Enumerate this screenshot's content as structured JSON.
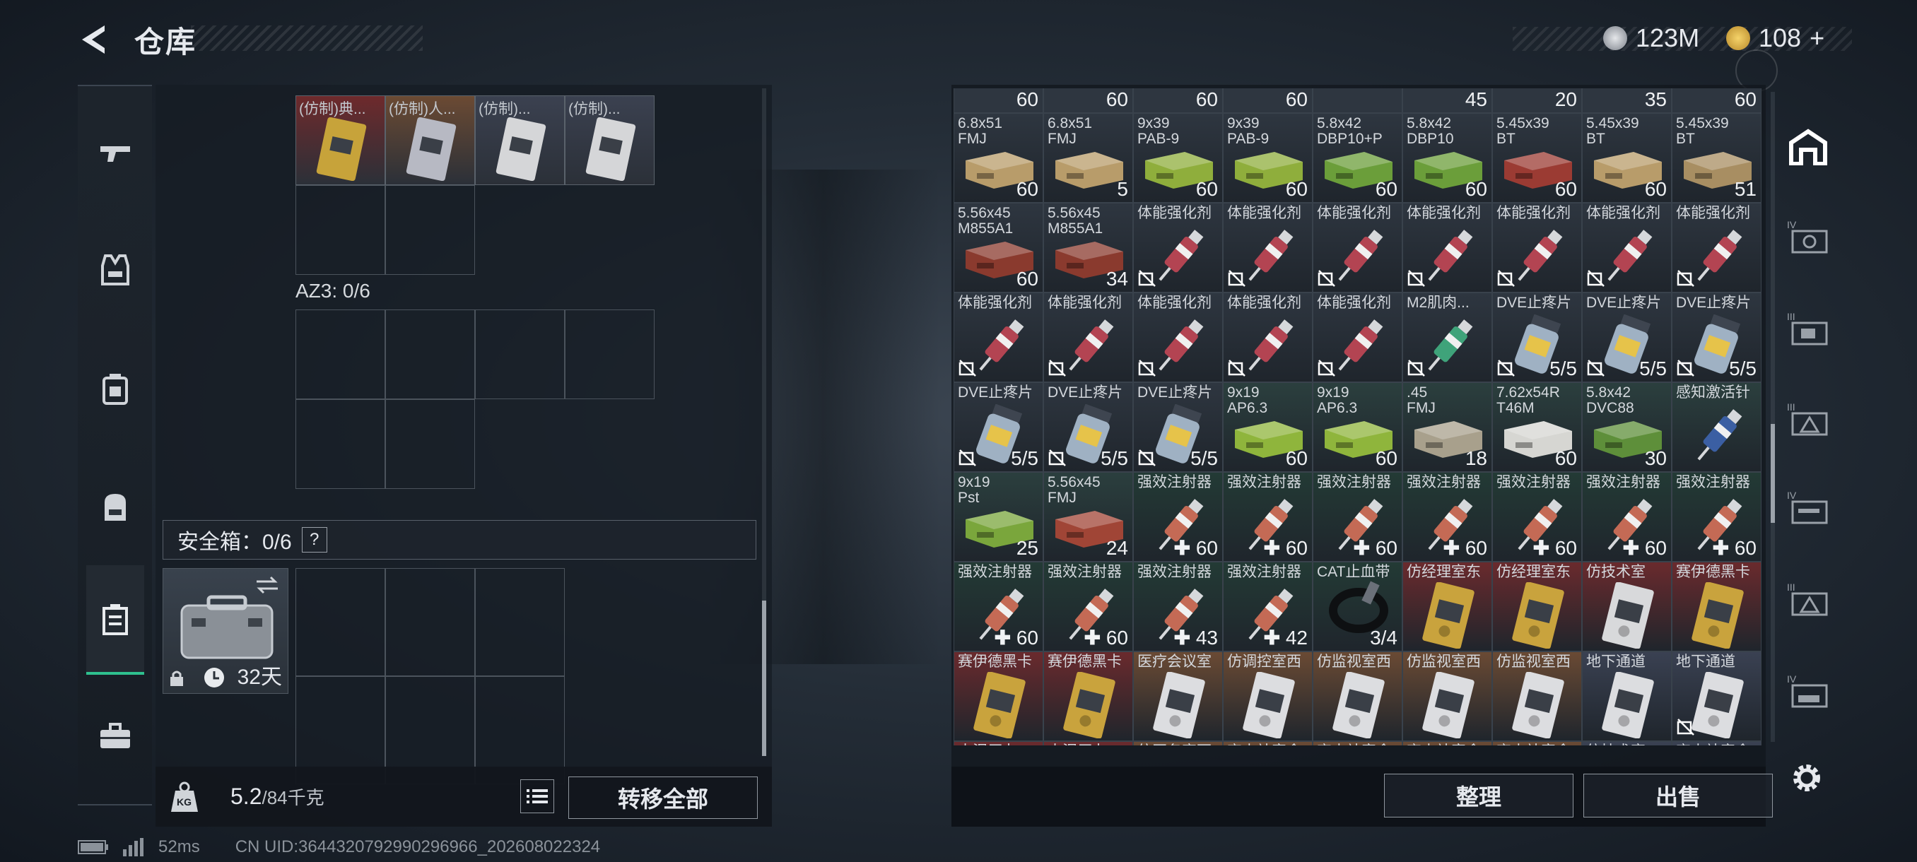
{
  "header": {
    "title": "仓库",
    "currency1": "123M",
    "currency2": "108",
    "currency2_plus": "+"
  },
  "nav": [
    "weapon-icon",
    "vest-icon",
    "armor-icon",
    "backpack-icon",
    "container-icon",
    "toolbox-icon"
  ],
  "left": {
    "top_items": [
      {
        "label": "(仿制)典...",
        "bg": "#6e2a2c",
        "card": "#c7a33a"
      },
      {
        "label": "(仿制)人...",
        "bg": "#6b4a33",
        "card": "#b7b9c3"
      },
      {
        "label": "(仿制)...",
        "bg": "#3b4150",
        "card": "#d5d6d8"
      },
      {
        "label": "(仿制)...",
        "bg": "#3b4150",
        "card": "#d5d6d8"
      }
    ],
    "az3_label": "AZ3: 0/6",
    "safe_label": "安全箱：0/6",
    "help": "?",
    "safe_days": "32天",
    "weight_value": "5.2",
    "weight_max": "/84千克",
    "kg_label": "KG",
    "transfer_label": "转移全部"
  },
  "status": {
    "ping": "52ms",
    "uid": "CN UID:3644320792990296966_202608022324"
  },
  "inventory": {
    "top_counts": [
      "60",
      "60",
      "60",
      "60",
      "",
      "45",
      "20",
      "35",
      "60"
    ],
    "rows": [
      [
        {
          "n": "6.8x51\nFMJ",
          "c": "60",
          "t": "ammo",
          "col": "#b89c6a",
          "bg": "#2e3640"
        },
        {
          "n": "6.8x51\nFMJ",
          "c": "5",
          "t": "ammo",
          "col": "#b89c6a",
          "bg": "#2e3640"
        },
        {
          "n": "9x39\nPAB-9",
          "c": "60",
          "t": "ammo",
          "col": "#8fae3c",
          "bg": "#2e3640"
        },
        {
          "n": "9x39\nPAB-9",
          "c": "60",
          "t": "ammo",
          "col": "#8fae3c",
          "bg": "#2e3640"
        },
        {
          "n": "5.8x42\nDBP10+P",
          "c": "60",
          "t": "ammo",
          "col": "#6b9e3a",
          "bg": "#2e3640"
        },
        {
          "n": "5.8x42\nDBP10",
          "c": "60",
          "t": "ammo",
          "col": "#6b9e3a",
          "bg": "#2e3640"
        },
        {
          "n": "5.45x39\nBT",
          "c": "60",
          "t": "ammo",
          "col": "#9b3b33",
          "bg": "#2e3640"
        },
        {
          "n": "5.45x39\nBT",
          "c": "60",
          "t": "ammo",
          "col": "#b89c6a",
          "bg": "#2e3640"
        },
        {
          "n": "5.45x39\nBT",
          "c": "51",
          "t": "ammo",
          "col": "#a88e62",
          "bg": "#2e3640"
        }
      ],
      [
        {
          "n": "5.56x45\nM855A1",
          "c": "60",
          "t": "ammo",
          "col": "#8a3a2e",
          "bg": "#2e3640"
        },
        {
          "n": "5.56x45\nM855A1",
          "c": "34",
          "t": "ammo",
          "col": "#8a3a2e",
          "bg": "#2e3640"
        },
        {
          "n": "体能强化剂",
          "c": "",
          "t": "syr",
          "col": "#b34452",
          "bg": "#2e3640",
          "ban": true
        },
        {
          "n": "体能强化剂",
          "c": "",
          "t": "syr",
          "col": "#b34452",
          "bg": "#2e3640",
          "ban": true
        },
        {
          "n": "体能强化剂",
          "c": "",
          "t": "syr",
          "col": "#b34452",
          "bg": "#2e3640",
          "ban": true
        },
        {
          "n": "体能强化剂",
          "c": "",
          "t": "syr",
          "col": "#b34452",
          "bg": "#2e3640",
          "ban": true
        },
        {
          "n": "体能强化剂",
          "c": "",
          "t": "syr",
          "col": "#b34452",
          "bg": "#2e3640",
          "ban": true
        },
        {
          "n": "体能强化剂",
          "c": "",
          "t": "syr",
          "col": "#b34452",
          "bg": "#2e3640",
          "ban": true
        },
        {
          "n": "体能强化剂",
          "c": "",
          "t": "syr",
          "col": "#b34452",
          "bg": "#2e3640",
          "ban": true
        }
      ],
      [
        {
          "n": "体能强化剂",
          "c": "",
          "t": "syr",
          "col": "#b34452",
          "bg": "#2e3640",
          "ban": true
        },
        {
          "n": "体能强化剂",
          "c": "",
          "t": "syr",
          "col": "#b34452",
          "bg": "#2e3640",
          "ban": true
        },
        {
          "n": "体能强化剂",
          "c": "",
          "t": "syr",
          "col": "#b34452",
          "bg": "#2e3640",
          "ban": true
        },
        {
          "n": "体能强化剂",
          "c": "",
          "t": "syr",
          "col": "#b34452",
          "bg": "#2e3640",
          "ban": true
        },
        {
          "n": "体能强化剂",
          "c": "",
          "t": "syr",
          "col": "#b34452",
          "bg": "#2e3640",
          "ban": true
        },
        {
          "n": "M2肌肉...",
          "c": "",
          "t": "syr",
          "col": "#3fa37a",
          "bg": "#2e3640",
          "ban": true
        },
        {
          "n": "DVE止疼片",
          "c": "5/5",
          "t": "pill",
          "col": "#9fb1c3",
          "bg": "#2e3640",
          "ban": true
        },
        {
          "n": "DVE止疼片",
          "c": "5/5",
          "t": "pill",
          "col": "#9fb1c3",
          "bg": "#2e3640",
          "ban": true
        },
        {
          "n": "DVE止疼片",
          "c": "5/5",
          "t": "pill",
          "col": "#9fb1c3",
          "bg": "#2e3640",
          "ban": true
        }
      ],
      [
        {
          "n": "DVE止疼片",
          "c": "5/5",
          "t": "pill",
          "col": "#9fb1c3",
          "bg": "#2e3640",
          "ban": true
        },
        {
          "n": "DVE止疼片",
          "c": "5/5",
          "t": "pill",
          "col": "#9fb1c3",
          "bg": "#2e3640",
          "ban": true
        },
        {
          "n": "DVE止疼片",
          "c": "5/5",
          "t": "pill",
          "col": "#9fb1c3",
          "bg": "#2e3640",
          "ban": true
        },
        {
          "n": "9x19\nAP6.3",
          "c": "60",
          "t": "ammo",
          "col": "#8fb53c",
          "bg": "#2b3f3e"
        },
        {
          "n": "9x19\nAP6.3",
          "c": "60",
          "t": "ammo",
          "col": "#8fb53c",
          "bg": "#2b3f3e"
        },
        {
          "n": ".45\nFMJ",
          "c": "18",
          "t": "ammo",
          "col": "#a8a08c",
          "bg": "#2b3f3e"
        },
        {
          "n": "7.62x54R\nT46M",
          "c": "60",
          "t": "ammo",
          "col": "#d6d6d2",
          "bg": "#2b3f3e"
        },
        {
          "n": "5.8x42\nDVC88",
          "c": "30",
          "t": "ammo",
          "col": "#5e8f3a",
          "bg": "#2b3f3e"
        },
        {
          "n": "感知激活针",
          "c": "",
          "t": "syr",
          "col": "#3b5fa3",
          "bg": "#2b3f3e"
        }
      ],
      [
        {
          "n": "9x19\nPst",
          "c": "25",
          "t": "ammo",
          "col": "#7aa63c",
          "bg": "#2b3f3e"
        },
        {
          "n": "5.56x45\nFMJ",
          "c": "24",
          "t": "ammo",
          "col": "#a04536",
          "bg": "#2b3f3e"
        },
        {
          "n": "强效注射器",
          "c": "60",
          "t": "syr",
          "col": "#c46a55",
          "bg": "#233a35",
          "plus": true
        },
        {
          "n": "强效注射器",
          "c": "60",
          "t": "syr",
          "col": "#c46a55",
          "bg": "#233a35",
          "plus": true
        },
        {
          "n": "强效注射器",
          "c": "60",
          "t": "syr",
          "col": "#c46a55",
          "bg": "#233a35",
          "plus": true
        },
        {
          "n": "强效注射器",
          "c": "60",
          "t": "syr",
          "col": "#c46a55",
          "bg": "#233a35",
          "plus": true
        },
        {
          "n": "强效注射器",
          "c": "60",
          "t": "syr",
          "col": "#c46a55",
          "bg": "#233a35",
          "plus": true
        },
        {
          "n": "强效注射器",
          "c": "60",
          "t": "syr",
          "col": "#c46a55",
          "bg": "#233a35",
          "plus": true
        },
        {
          "n": "强效注射器",
          "c": "60",
          "t": "syr",
          "col": "#c46a55",
          "bg": "#233a35",
          "plus": true
        }
      ],
      [
        {
          "n": "强效注射器",
          "c": "60",
          "t": "syr",
          "col": "#c46a55",
          "bg": "#233a35",
          "plus": true
        },
        {
          "n": "强效注射器",
          "c": "60",
          "t": "syr",
          "col": "#c46a55",
          "bg": "#233a35",
          "plus": true
        },
        {
          "n": "强效注射器",
          "c": "43",
          "t": "syr",
          "col": "#c46a55",
          "bg": "#233a35",
          "plus": true
        },
        {
          "n": "强效注射器",
          "c": "42",
          "t": "syr",
          "col": "#c46a55",
          "bg": "#233a35",
          "plus": true
        },
        {
          "n": "CAT止血带",
          "c": "3/4",
          "t": "tq",
          "col": "#1c1f24",
          "bg": "#233a35"
        },
        {
          "n": "仿经理室东",
          "c": "",
          "t": "card",
          "col": "#c9a33d",
          "bg": "#6a2a2d"
        },
        {
          "n": "仿经理室东",
          "c": "",
          "t": "card",
          "col": "#c9a33d",
          "bg": "#6a2a2d"
        },
        {
          "n": "仿技术室",
          "c": "",
          "t": "card",
          "col": "#d8d9db",
          "bg": "#6a2a2d"
        },
        {
          "n": "赛伊德黑卡",
          "c": "",
          "t": "card",
          "col": "#c9a33d",
          "bg": "#6a2a2d"
        }
      ],
      [
        {
          "n": "赛伊德黑卡",
          "c": "",
          "t": "card",
          "col": "#c9a33d",
          "bg": "#6a2a2d"
        },
        {
          "n": "赛伊德黑卡",
          "c": "",
          "t": "card",
          "col": "#c9a33d",
          "bg": "#6a2a2d"
        },
        {
          "n": "医疗会议室",
          "c": "",
          "t": "card",
          "col": "#dcdde0",
          "bg": "#6a4a34"
        },
        {
          "n": "仿调控室西",
          "c": "",
          "t": "card",
          "col": "#dcdde0",
          "bg": "#6a4a34"
        },
        {
          "n": "仿监视室西",
          "c": "",
          "t": "card",
          "col": "#dcdde0",
          "bg": "#6a4a34"
        },
        {
          "n": "仿监视室西",
          "c": "",
          "t": "card",
          "col": "#dcdde0",
          "bg": "#6a4a34"
        },
        {
          "n": "仿监视室西",
          "c": "",
          "t": "card",
          "col": "#dcdde0",
          "bg": "#6a4a34"
        },
        {
          "n": "地下通道",
          "c": "",
          "t": "card",
          "col": "#dcdde0",
          "bg": "#3a4152"
        },
        {
          "n": "地下通道",
          "c": "",
          "t": "card",
          "col": "#dcdde0",
          "bg": "#3a4152",
          "ban": true
        }
      ],
      [
        {
          "n": "水泥厂办...",
          "c": "",
          "t": "card",
          "col": "#c9a33d",
          "bg": "#6a2a2d"
        },
        {
          "n": "水泥厂办...",
          "c": "",
          "t": "card",
          "col": "#c9a33d",
          "bg": "#6a2a2d"
        },
        {
          "n": "仿医务室西",
          "c": "",
          "t": "card",
          "col": "#dcdde0",
          "bg": "#6a4a34"
        },
        {
          "n": "变电站宿舍",
          "c": "",
          "t": "card",
          "col": "#dcdde0",
          "bg": "#6a4a34"
        },
        {
          "n": "变电站宿舍",
          "c": "",
          "t": "card",
          "col": "#dcdde0",
          "bg": "#6a4a34"
        },
        {
          "n": "变电站宿舍",
          "c": "",
          "t": "card",
          "col": "#dcdde0",
          "bg": "#6a4a34"
        },
        {
          "n": "变电站宿舍",
          "c": "",
          "t": "card",
          "col": "#dcdde0",
          "bg": "#6a4a34"
        },
        {
          "n": "仿技术室",
          "c": "",
          "t": "card",
          "col": "#dcdde0",
          "bg": "#3a4152"
        },
        {
          "n": "变电站宿舍",
          "c": "",
          "t": "card",
          "col": "#dcdde0",
          "bg": "#3a4152"
        }
      ]
    ],
    "sort_label": "整理",
    "sell_label": "出售"
  },
  "right_nav": [
    "safehouse-icon",
    "iv-weapon-icon",
    "iii-vest-icon",
    "iii-armor-icon",
    "iv-helmet-icon",
    "iii-bag-icon",
    "iv-rig-icon",
    "settings-icon"
  ],
  "rnav_labels": {
    "a": "IV",
    "b": "III",
    "c": "III",
    "d": "IV",
    "e": "III",
    "f": "IV"
  }
}
